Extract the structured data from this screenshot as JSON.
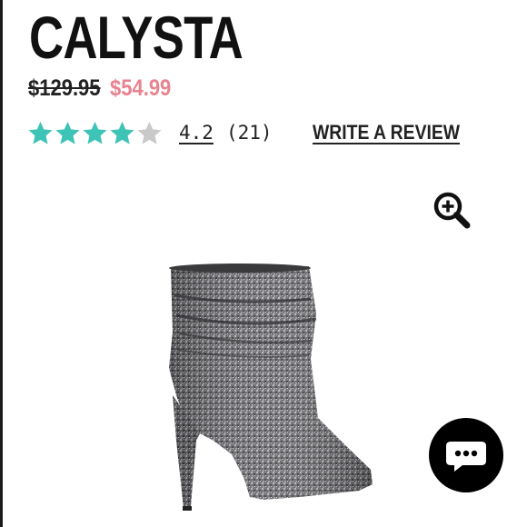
{
  "product": {
    "name": "CALYSTA",
    "price_original": "$129.95",
    "price_sale": "$54.99"
  },
  "rating": {
    "stars_filled": 4,
    "stars_total": 5,
    "value": "4.2",
    "count": "(21)",
    "write_review_label": "WRITE A REVIEW"
  },
  "icons": {
    "star": "star-icon",
    "zoom": "zoom-in-icon",
    "chat": "chat-bubble-icon"
  },
  "colors": {
    "star_filled": "#3ec4b6",
    "star_empty": "#c9c9c9",
    "sale_price": "#e8838f",
    "chat_button": "#000000"
  }
}
